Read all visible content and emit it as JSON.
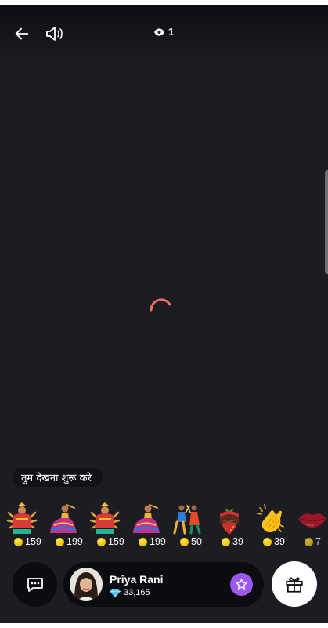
{
  "topbar": {
    "back_icon": "arrow-left-icon",
    "volume_icon": "speaker-icon",
    "viewers_icon": "eye-icon",
    "viewer_count": "1"
  },
  "stream": {
    "loading_icon": "spinner-icon"
  },
  "prompt": {
    "text": "तुम देखना शुरू करे"
  },
  "gifts": [
    {
      "name": "goddess",
      "icon": "goddess-sticker-icon",
      "price": "159"
    },
    {
      "name": "garba-dancer",
      "icon": "garba-dancer-sticker-icon",
      "price": "199"
    },
    {
      "name": "goddess",
      "icon": "goddess-sticker-icon",
      "price": "159"
    },
    {
      "name": "garba-dancer",
      "icon": "garba-dancer-sticker-icon",
      "price": "199"
    },
    {
      "name": "dandiya-dancers",
      "icon": "dandiya-dancers-sticker-icon",
      "price": "50"
    },
    {
      "name": "chocolate-strawberry",
      "icon": "strawberry-icon",
      "price": "39"
    },
    {
      "name": "clapping-hands",
      "icon": "clapping-hands-icon",
      "price": "39"
    },
    {
      "name": "lips",
      "icon": "lips-icon",
      "price": "7"
    }
  ],
  "bottombar": {
    "chat_icon": "chat-bubble-icon",
    "host_name": "Priya Rani",
    "diamond_icon": "diamond-icon",
    "diamond_count": "33,165",
    "follow_icon": "star-icon",
    "gift_icon": "gift-icon"
  },
  "colors": {
    "background": "#1b1d22",
    "accent_purple": "#9b59f0",
    "spinner": "#f26d5b",
    "coin": "#f5c400",
    "diamond": "#4fc3f7"
  }
}
